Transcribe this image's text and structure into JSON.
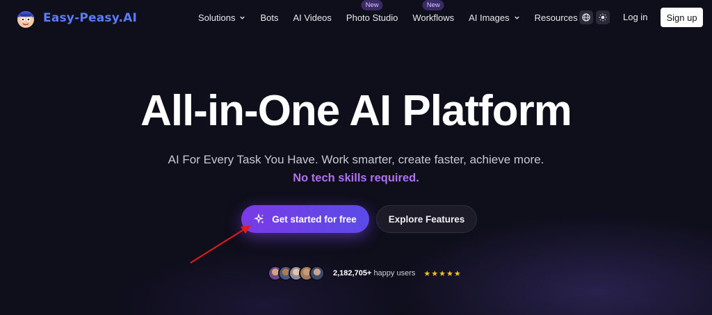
{
  "brand": {
    "name": "Easy-Peasy.AI",
    "color": "#5b7cff"
  },
  "nav": {
    "items": [
      {
        "label": "Solutions",
        "dropdown": true,
        "badge": ""
      },
      {
        "label": "Bots",
        "dropdown": false,
        "badge": ""
      },
      {
        "label": "AI Videos",
        "dropdown": false,
        "badge": ""
      },
      {
        "label": "Photo Studio",
        "dropdown": false,
        "badge": "New"
      },
      {
        "label": "Workflows",
        "dropdown": false,
        "badge": "New"
      },
      {
        "label": "AI Images",
        "dropdown": true,
        "badge": ""
      },
      {
        "label": "Resources",
        "dropdown": true,
        "badge": ""
      }
    ],
    "icons": [
      "globe-icon",
      "sun-icon"
    ],
    "login": "Log in",
    "signup": "Sign up"
  },
  "hero": {
    "title": "All-in-One AI Platform",
    "subtitle": "AI For Every Task You Have. Work smarter, create faster, achieve more.",
    "tagline": "No tech skills required.",
    "cta_primary": "Get started for free",
    "cta_secondary": "Explore Features"
  },
  "social_proof": {
    "count": "2,182,705+",
    "suffix": "happy users",
    "stars": "★★★★★",
    "rating": 5
  },
  "colors": {
    "accent": "#7a3be6",
    "tagline": "#b072f0",
    "star": "#f5c518",
    "annotation_arrow": "#e01b1b"
  }
}
